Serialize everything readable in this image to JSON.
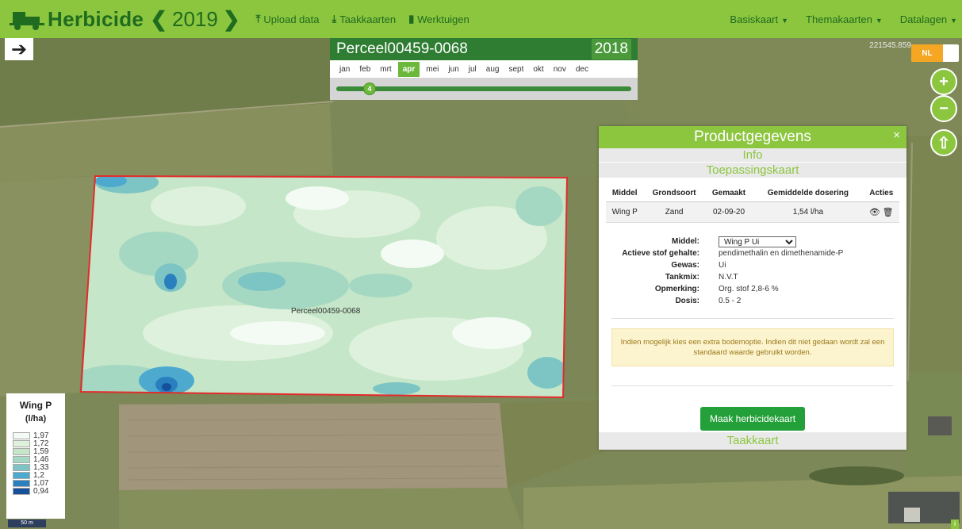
{
  "header": {
    "brand": "Herbicide",
    "year": "2019",
    "prev_icon": "chevron-left-icon",
    "next_icon": "chevron-right-icon",
    "buttons": [
      {
        "label": "Upload data",
        "icon": "upload-icon"
      },
      {
        "label": "Taakkaarten",
        "icon": "download-icon"
      },
      {
        "label": "Werktuigen",
        "icon": "tools-icon"
      }
    ],
    "menus": [
      {
        "label": "Basiskaart"
      },
      {
        "label": "Themakaarten"
      },
      {
        "label": "Datalagen"
      }
    ],
    "colors": {
      "bar": "#8cc63f",
      "text": "#1f6b1f"
    }
  },
  "month_panel": {
    "title": "Perceel00459-0068",
    "year": "2018",
    "months": [
      "jan",
      "feb",
      "mrt",
      "apr",
      "mei",
      "jun",
      "jul",
      "aug",
      "sept",
      "okt",
      "nov",
      "dec"
    ],
    "selected_month": "apr",
    "slider_value": "4"
  },
  "map": {
    "coordinate": "221545.859",
    "language": "NL",
    "field_label": "Perceel00459-0068",
    "scale_label": "50 m",
    "info_icon": "i"
  },
  "legend": {
    "title": "Wing P",
    "unit": "(l/ha)",
    "entries": [
      {
        "value": "1,97",
        "color": "#f4fbf4"
      },
      {
        "value": "1,72",
        "color": "#ddf1dc"
      },
      {
        "value": "1,59",
        "color": "#c5e6c8"
      },
      {
        "value": "1,46",
        "color": "#a5d8c2"
      },
      {
        "value": "1,33",
        "color": "#7cc5c4"
      },
      {
        "value": "1,2",
        "color": "#4ea9cf"
      },
      {
        "value": "1,07",
        "color": "#2a7fbf"
      },
      {
        "value": "0,94",
        "color": "#15509b"
      }
    ]
  },
  "panel": {
    "title": "Productgegevens",
    "close": "×",
    "sections": {
      "info": "Info",
      "toepassing": "Toepassingskaart",
      "taak": "Taakkaart"
    },
    "table": {
      "headers": [
        "Middel",
        "Grondsoort",
        "Gemaakt",
        "Gemiddelde dosering",
        "Acties"
      ],
      "rows": [
        {
          "middel": "Wing P",
          "grond": "Zand",
          "gemaakt": "02-09-20",
          "dosering": "1,54 l/ha"
        }
      ]
    },
    "details": {
      "middel_label": "Middel:",
      "middel_value": "Wing P Ui",
      "stof_label": "Actieve stof gehalte:",
      "stof_value": "pendimethalin en dimethenamide-P",
      "gewas_label": "Gewas:",
      "gewas_value": "Ui",
      "tankmix_label": "Tankmix:",
      "tankmix_value": "N.V.T",
      "opmerking_label": "Opmerking:",
      "opmerking_value": "Org. stof 2,8-6 %",
      "dosis_label": "Dosis:",
      "dosis_value": "0.5 - 2"
    },
    "warning": "Indien mogelijk kies een extra bodemoptie. Indien dit niet gedaan wordt zal een standaard waarde gebruikt worden.",
    "button": "Maak herbicidekaart"
  }
}
